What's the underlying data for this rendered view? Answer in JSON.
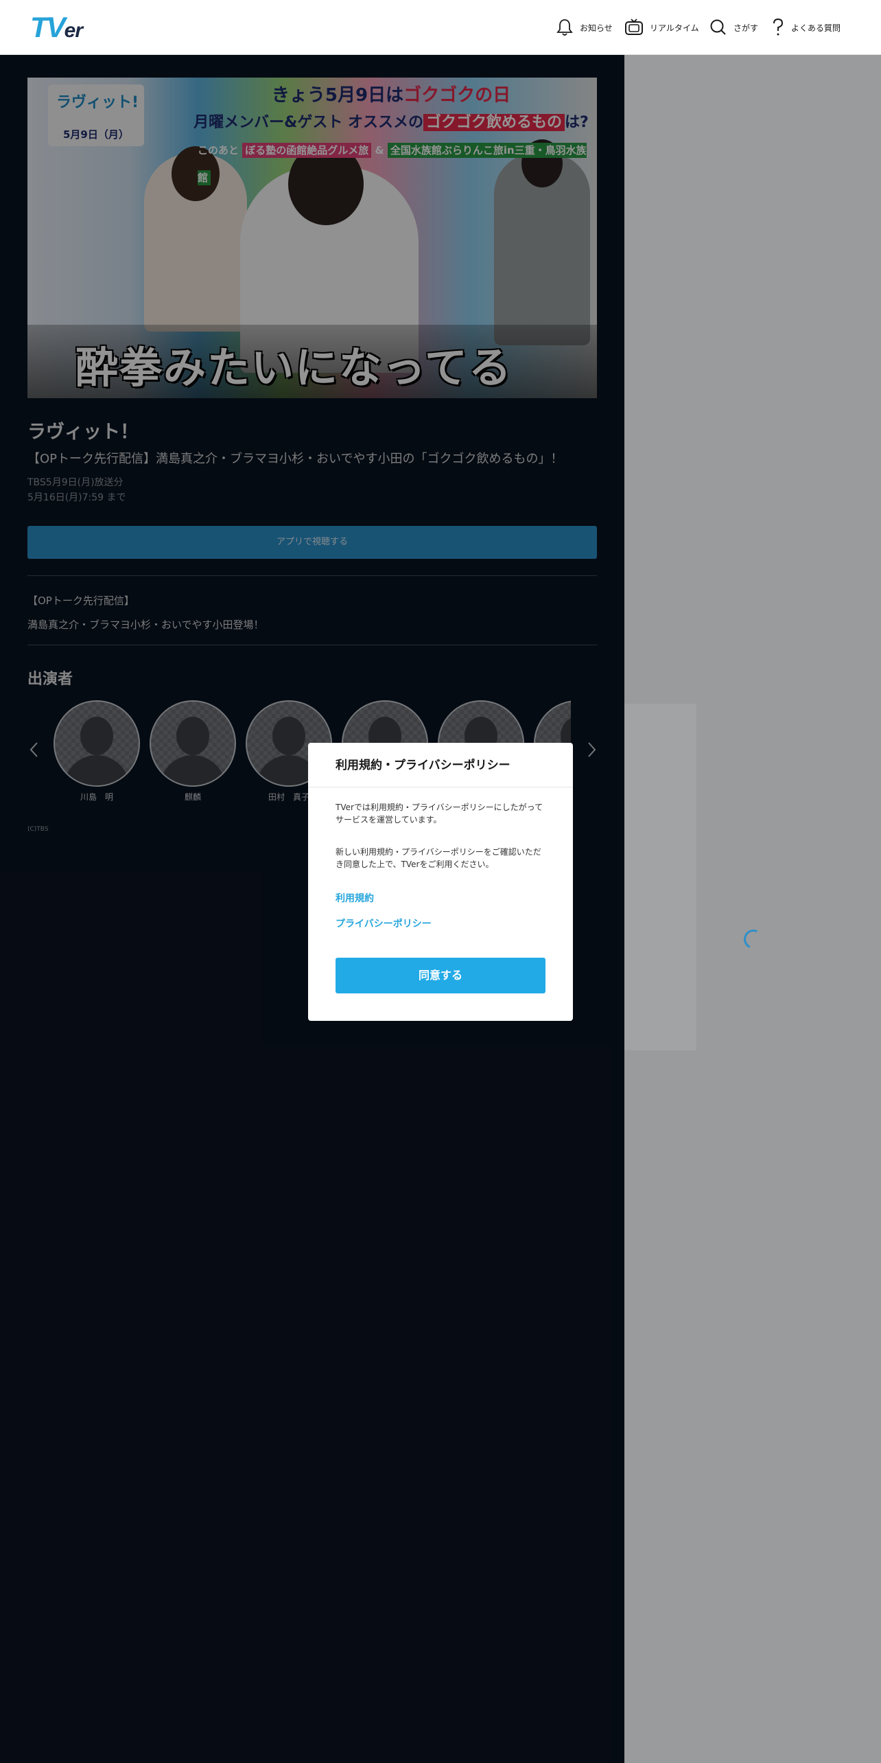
{
  "header": {
    "logo": {
      "main": "TV",
      "tail": "er"
    },
    "nav": [
      {
        "label": "お知らせ",
        "icon": "bell-icon"
      },
      {
        "label": "リアルタイム",
        "icon": "tv-icon"
      },
      {
        "label": "さがす",
        "icon": "search-icon"
      },
      {
        "label": "よくある質問",
        "icon": "question-icon"
      }
    ]
  },
  "thumbnail": {
    "show_logo": "ラヴィット!",
    "show_date": "5月9日（月）",
    "banner_line1_a": "きょう5月9日は",
    "banner_line1_b": "ゴクゴクの日",
    "banner_line2_a": "月曜メンバー&ゲスト オススメの",
    "banner_line2_b": "ゴクゴク飲めるもの",
    "banner_line2_c": "は?",
    "banner_line3_a": "このあと",
    "banner_line3_b": "ぼる塾の函館絶品グルメ旅",
    "banner_line3_c": "&",
    "banner_line3_d": "全国水族館ぶらりんこ旅in三重・鳥羽水族館",
    "caption": "酔拳みたいになってる"
  },
  "episode": {
    "title": "ラヴィット！",
    "subtitle": "【OPトーク先行配信】満島真之介・ブラマヨ小杉・おいでやす小田の「ゴクゴク飲めるもの」！",
    "broadcast": "TBS5月9日(月)放送分",
    "expiry": "5月16日(月)7:59 まで",
    "app_button": "アプリで視聴する",
    "description_1": "【OPトーク先行配信】",
    "description_2": "満島真之介・ブラマヨ小杉・おいでやす小田登場！"
  },
  "cast": {
    "heading": "出演者",
    "members": [
      {
        "name": "川島　明"
      },
      {
        "name": "麒麟"
      },
      {
        "name": "田村　真子"
      },
      {
        "name": ""
      },
      {
        "name": ""
      },
      {
        "name": ""
      }
    ]
  },
  "copyright": "(C)TBS",
  "modal": {
    "title": "利用規約・プライバシーポリシー",
    "text_1": "TVerでは利用規約・プライバシーポリシーにしたがってサービスを運営しています。",
    "text_2": "新しい利用規約・プライバシーポリシーをご確認いただき同意した上で、TVerをご利用ください。",
    "link_terms": "利用規約",
    "link_privacy": "プライバシーポリシー",
    "agree_button": "同意する"
  },
  "colors": {
    "accent": "#22aae6",
    "main_bg": "#0a1322",
    "overlay": "#9a9b9d"
  }
}
